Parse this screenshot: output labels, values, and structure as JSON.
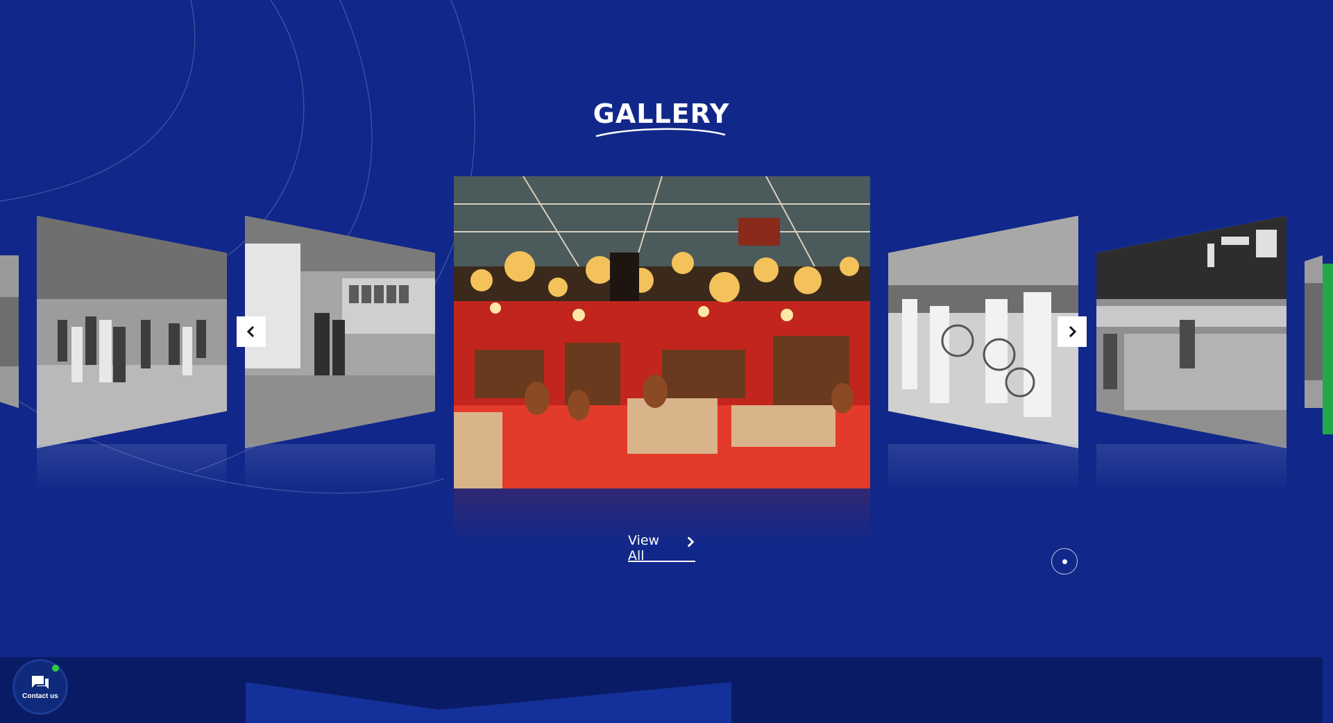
{
  "section": {
    "title": "GALLERY",
    "view_all_label": "View All"
  },
  "carousel": {
    "prev_label": "Previous",
    "next_label": "Next",
    "active_index": 2,
    "slide_count": 6
  },
  "contact": {
    "label": "Contact us"
  },
  "colors": {
    "background": "#11288a",
    "footer": "#0a1b66",
    "accent_green": "#22a84a",
    "online": "#2ecc40"
  }
}
